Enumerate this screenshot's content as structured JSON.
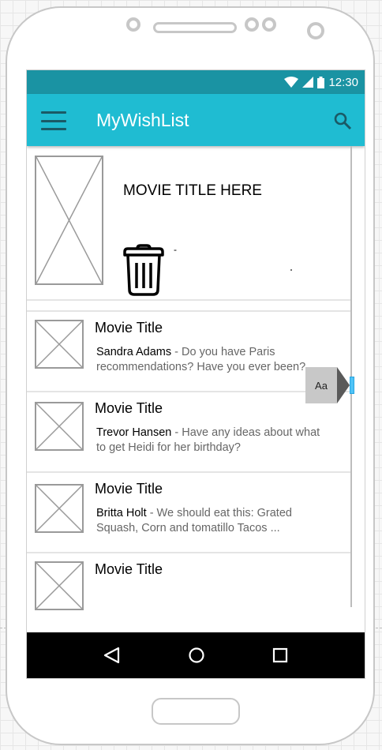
{
  "status_bar": {
    "time": "12:30"
  },
  "app_bar": {
    "title": "MyWishList"
  },
  "featured": {
    "title": "MOVIE TITLE HERE",
    "dash": "-"
  },
  "list": [
    {
      "title": "Movie Title",
      "sender": "Sandra Adams",
      "message": " - Do you have Paris",
      "message2": "recommendations? Have you ever been?"
    },
    {
      "title": "Movie Title",
      "sender": "Trevor Hansen",
      "message": " - Have any ideas about what",
      "message2": "to get Heidi for her birthday?"
    },
    {
      "title": "Movie Title",
      "sender": "Britta Holt",
      "message": " - We should eat this: Grated",
      "message2": "Squash, Corn and tomatillo Tacos ..."
    },
    {
      "title": "Movie Title",
      "sender": "",
      "message": "",
      "message2": ""
    }
  ],
  "tooltip": {
    "label": "Aa"
  },
  "icons": {
    "menu": "hamburger-icon",
    "search": "search-icon",
    "trash": "trash-icon",
    "back": "back-triangle-icon",
    "home": "home-circle-icon",
    "recents": "recents-square-icon"
  },
  "colors": {
    "status_bar": "#1a93a3",
    "app_bar": "#1fbcd2",
    "accent": "#4fc3f7"
  }
}
